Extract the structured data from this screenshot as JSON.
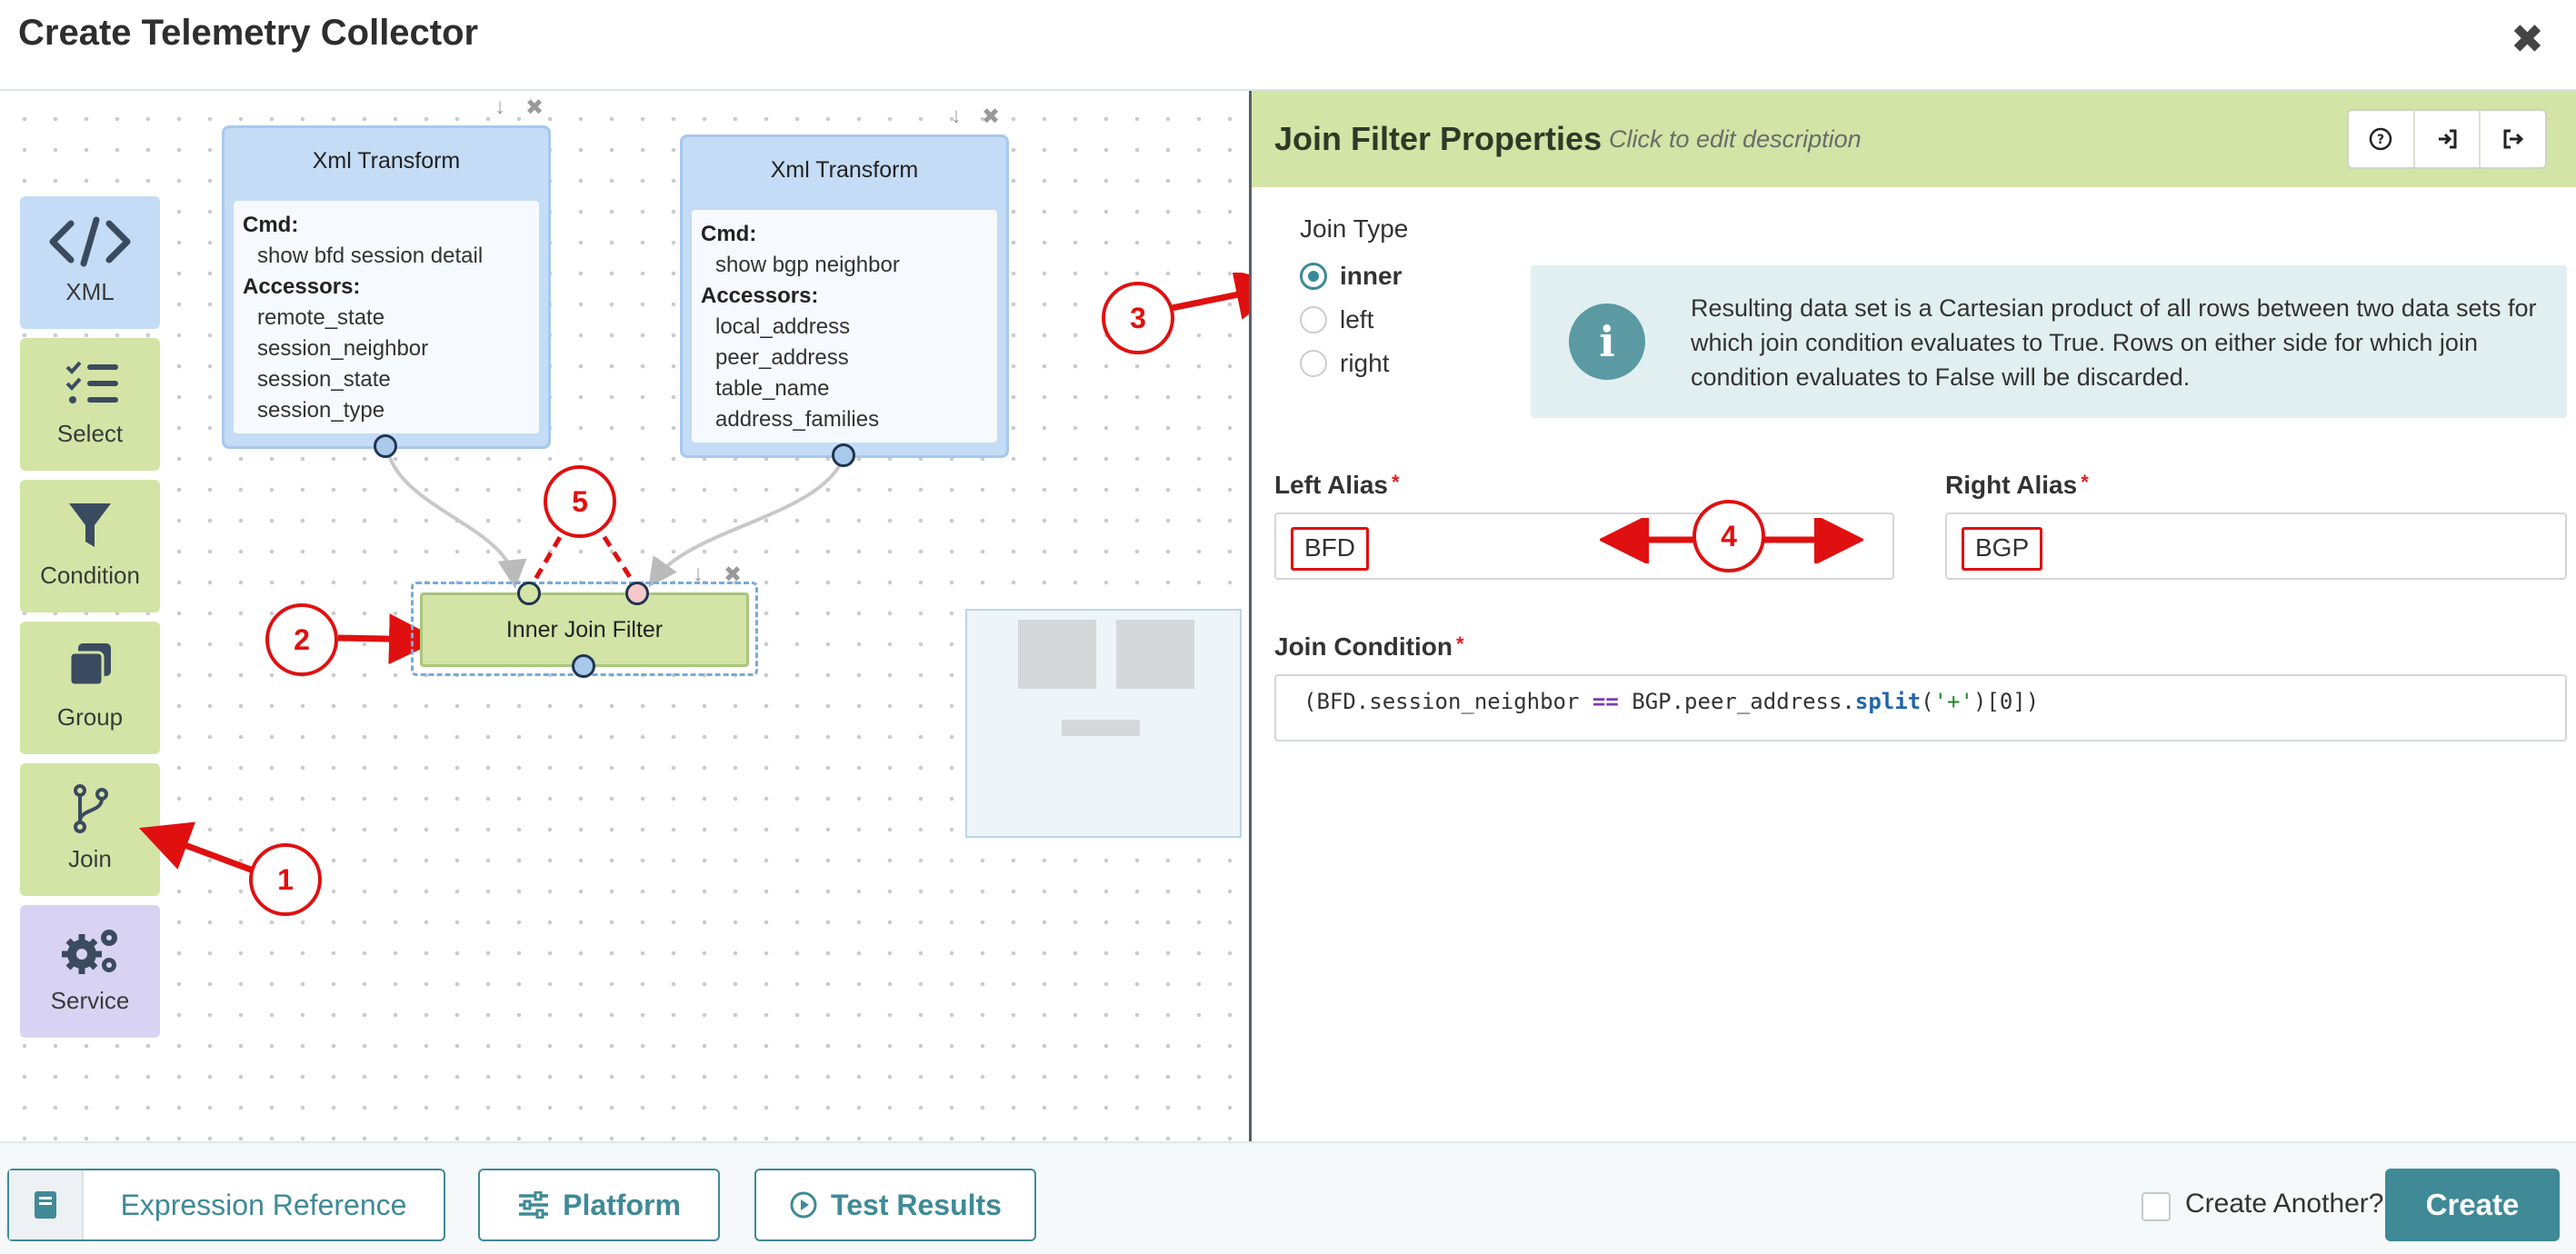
{
  "header": {
    "title": "Create Telemetry Collector",
    "close_glyph": "✖"
  },
  "palette": [
    {
      "label": "XML",
      "icon": "code-icon"
    },
    {
      "label": "Select",
      "icon": "checklist-icon"
    },
    {
      "label": "Condition",
      "icon": "filter-icon"
    },
    {
      "label": "Group",
      "icon": "stack-icon"
    },
    {
      "label": "Join",
      "icon": "branch-icon"
    },
    {
      "label": "Service",
      "icon": "gears-icon"
    }
  ],
  "nodes": {
    "xml1": {
      "title": "Xml Transform",
      "cmd_label": "Cmd:",
      "cmd": "show bfd session detail",
      "accessors_label": "Accessors:",
      "accessors": [
        "remote_state",
        "session_neighbor",
        "session_state",
        "session_type"
      ]
    },
    "xml2": {
      "title": "Xml Transform",
      "cmd_label": "Cmd:",
      "cmd": "show bgp neighbor",
      "accessors_label": "Accessors:",
      "accessors": [
        "local_address",
        "peer_address",
        "table_name",
        "address_families"
      ]
    },
    "join": {
      "title": "Inner Join Filter"
    },
    "controls": {
      "down": "↓",
      "remove": "✖"
    }
  },
  "panel": {
    "title": "Join Filter Properties",
    "description": "Click to edit description",
    "join_type_label": "Join Type",
    "join_types": [
      "inner",
      "left",
      "right"
    ],
    "selected_join_type": "inner",
    "info_text": "Resulting data set is a Cartesian product of all rows between two data sets for which join condition evaluates to True. Rows on either side for which join condition evaluates to False will be discarded.",
    "left_alias_label": "Left Alias",
    "left_alias": "BFD",
    "right_alias_label": "Right Alias",
    "right_alias": "BGP",
    "required_mark": "*",
    "join_condition_label": "Join Condition",
    "join_condition": {
      "open": "(BFD.session_neighbor ",
      "op": "==",
      "mid": " BGP.peer_address.",
      "fn": "split",
      "paren_open": "(",
      "arg": "'+'",
      "close": ")[0])"
    }
  },
  "footer": {
    "expression_reference": "Expression Reference",
    "platform": "Platform",
    "test_results": "Test Results",
    "create_another": "Create Another?",
    "create": "Create"
  },
  "callouts": [
    "1",
    "2",
    "3",
    "4",
    "5"
  ],
  "colors": {
    "accent": "#3f8a96",
    "node_blue": "#c4dcf5",
    "node_green": "#d3e4a6",
    "annotation_red": "#e01010"
  }
}
